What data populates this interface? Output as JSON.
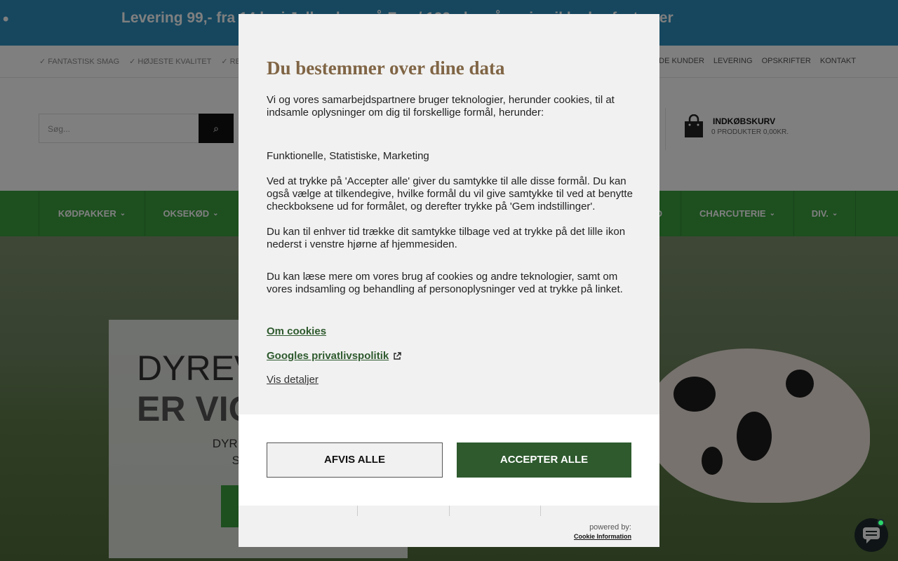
{
  "announcement": {
    "bullet": "•",
    "text": "Levering 99,- fra 14 kr. i Jylland og på Fyn / 199,- kr. på øvrige ikke-brofaste øer"
  },
  "usp": {
    "left": [
      "✓ FANTASTISK SMAG",
      "✓ HØJESTE KVALITET",
      "✓ RE"
    ],
    "right": [
      "GLADE KUNDER",
      "LEVERING",
      "OPSKRIFTER",
      "KONTAKT"
    ]
  },
  "header": {
    "search_placeholder": "Søg...",
    "cart_title": "INDKØBSKURV",
    "cart_sub": "0 PRODUKTER 0,00KR."
  },
  "nav": {
    "items": [
      "KØDPAKKER",
      "OKSEKØD",
      "D",
      "CHARCUTERIE",
      "DIV."
    ]
  },
  "hero": {
    "line1": "DYREV",
    "line2": "ER VIG",
    "text_line1": "DYRENES LEVE",
    "text_line2": "SÅDAN V"
  },
  "consent": {
    "title": "Du bestemmer over dine data",
    "intro": "Vi og vores samarbejdspartnere bruger teknologier, herunder cookies, til at indsamle oplysninger om dig til forskellige formål, herunder:",
    "purposes": "Funktionelle, Statistiske, Marketing",
    "consent_text": "Ved at trykke på 'Accepter alle' giver du samtykke til alle disse formål. Du kan også vælge at tilkendegive, hvilke formål du vil give samtykke til ved at benytte checkboksene ud for formålet, og derefter trykke på 'Gem indstillinger'.",
    "withdraw_text": "Du kan til enhver tid trække dit samtykke tilbage ved at trykke på det lille ikon nederst i venstre hjørne af hjemmesiden.",
    "more_text": "Du kan læse mere om vores brug af cookies og andre teknologier, samt om vores indsamling og behandling af personoplysninger ved at trykke på linket.",
    "link_cookies": "Om cookies",
    "link_google": "Googles privatlivspolitik",
    "link_details": "Vis detaljer",
    "reject_label": "AFVIS ALLE",
    "accept_label": "ACCEPTER ALLE",
    "powered_by": "powered by:",
    "powered_logo": "Cookie Information"
  },
  "colors": {
    "announce_bg": "#2d8fbe",
    "nav_bg": "#3a9e3e",
    "title_brown": "#806545",
    "accept_green": "#2e5a2e"
  }
}
